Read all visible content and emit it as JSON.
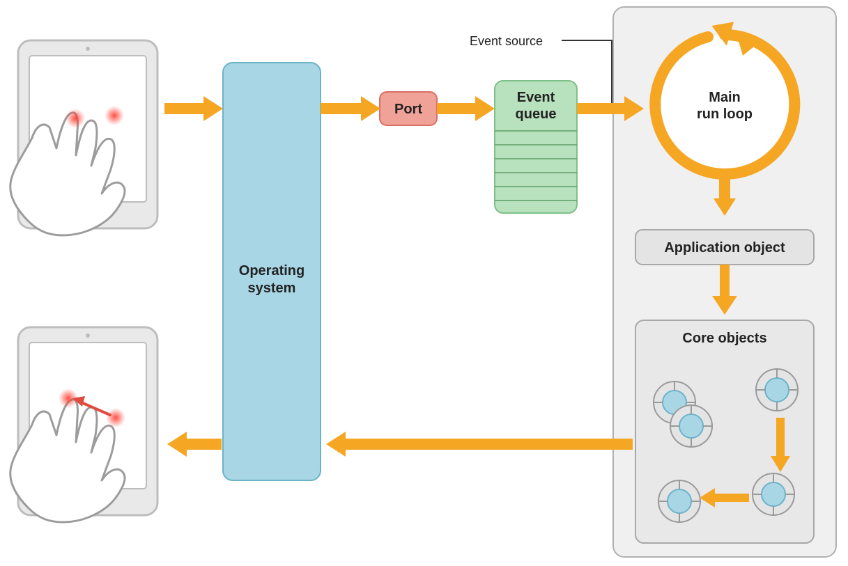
{
  "labels": {
    "event_source": "Event source",
    "operating_system_l1": "Operating",
    "operating_system_l2": "system",
    "port": "Port",
    "event_queue_l1": "Event",
    "event_queue_l2": "queue",
    "main_run_loop_l1": "Main",
    "main_run_loop_l2": "run loop",
    "application_object": "Application object",
    "core_objects": "Core objects"
  },
  "colors": {
    "arrow": "#f5a623",
    "os_fill": "#a9d6e5",
    "os_stroke": "#6bb3c9",
    "port_fill": "#f1a298",
    "port_stroke": "#d96f62",
    "queue_fill": "#b8e1bd",
    "queue_stroke": "#7fbf88",
    "panel_fill": "#f0f0f0",
    "panel_stroke": "#b0b0b0",
    "box_fill": "#e4e4e4",
    "box_stroke": "#a8a8a8",
    "device_stroke": "#bdbdbd",
    "hand_stroke": "#9c9c9c",
    "touch_red": "#e04a3f",
    "cog_fill": "#a9d6e5"
  }
}
